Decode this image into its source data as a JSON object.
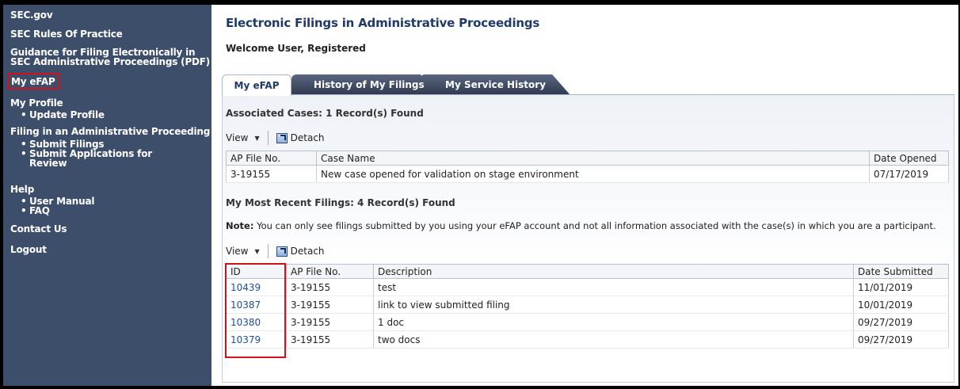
{
  "sidebar": {
    "sec_gov": "SEC.gov",
    "rules": "SEC Rules Of Practice",
    "guidance_line1": "Guidance for Filing Electronically in",
    "guidance_line2": "SEC Administrative Proceedings (PDF)",
    "my_efap": "My eFAP",
    "my_profile": "My Profile",
    "update_profile": "Update Profile",
    "filing": "Filing in an Administrative Proceeding",
    "submit_filings": "Submit Filings",
    "submit_apps_line1": "Submit Applications for",
    "submit_apps_line2": "Review",
    "help": "Help",
    "user_manual": "User Manual",
    "faq": "FAQ",
    "contact": "Contact Us",
    "logout": "Logout",
    "bullet": "•"
  },
  "header": {
    "title": "Electronic Filings in Administrative Proceedings",
    "welcome": "Welcome User, Registered"
  },
  "tabs": [
    {
      "label": "My eFAP",
      "active": true
    },
    {
      "label": "History of My Filings",
      "active": false
    },
    {
      "label": "My Service History",
      "active": false
    }
  ],
  "cases": {
    "heading": "Associated Cases: 1 Record(s) Found",
    "view_label": "View",
    "detach_label": "Detach",
    "columns": [
      "AP File No.",
      "Case Name",
      "Date Opened"
    ],
    "rows": [
      {
        "ap": "3-19155",
        "name": "New case opened for validation on stage environment",
        "date": "07/17/2019"
      }
    ]
  },
  "filings": {
    "heading": "My Most Recent Filings: 4 Record(s) Found",
    "note_label": "Note:",
    "note_text": " You can only see filings submitted by you using your eFAP account and not all information associated with the case(s) in which you are a participant.",
    "view_label": "View",
    "detach_label": "Detach",
    "columns": [
      "ID",
      "AP File No.",
      "Description",
      "Date Submitted"
    ],
    "rows": [
      {
        "id": "10439",
        "ap": "3-19155",
        "desc": "test",
        "date": "11/01/2019"
      },
      {
        "id": "10387",
        "ap": "3-19155",
        "desc": "link to view submitted filing",
        "date": "10/01/2019"
      },
      {
        "id": "10380",
        "ap": "3-19155",
        "desc": "1 doc",
        "date": "09/27/2019"
      },
      {
        "id": "10379",
        "ap": "3-19155",
        "desc": "two docs",
        "date": "09/27/2019"
      }
    ]
  },
  "colors": {
    "sidebar_bg": "#3d4e6a",
    "title": "#1f3a66",
    "highlight": "#d0101c",
    "link": "#1b4f9c"
  }
}
